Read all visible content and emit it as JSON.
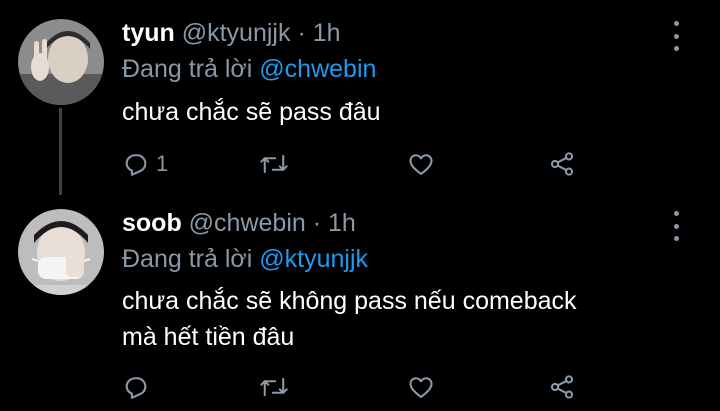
{
  "colors": {
    "background": "#000000",
    "text": "#ffffff",
    "muted": "#8b98a5",
    "link": "#1d9bf0",
    "thread_line": "#38444d"
  },
  "tweets": [
    {
      "display_name": "tyun",
      "handle": "@ktyunjjk",
      "separator": "·",
      "time": "1h",
      "replying_prefix": "Đang trả lời",
      "replying_to": "@chwebin",
      "text_lines": [
        "chưa chắc sẽ pass đâu"
      ],
      "reply_count": "1",
      "icons": [
        "reply-icon",
        "retweet-icon",
        "like-icon",
        "share-icon",
        "more-icon"
      ]
    },
    {
      "display_name": "soob",
      "handle": "@chwebin",
      "separator": "·",
      "time": "1h",
      "replying_prefix": "Đang trả lời",
      "replying_to": "@ktyunjjk",
      "text_lines": [
        "chưa chắc sẽ không pass nếu comeback",
        "mà hết tiền đâu"
      ],
      "reply_count": "",
      "icons": [
        "reply-icon",
        "retweet-icon",
        "like-icon",
        "share-icon",
        "more-icon"
      ]
    }
  ]
}
